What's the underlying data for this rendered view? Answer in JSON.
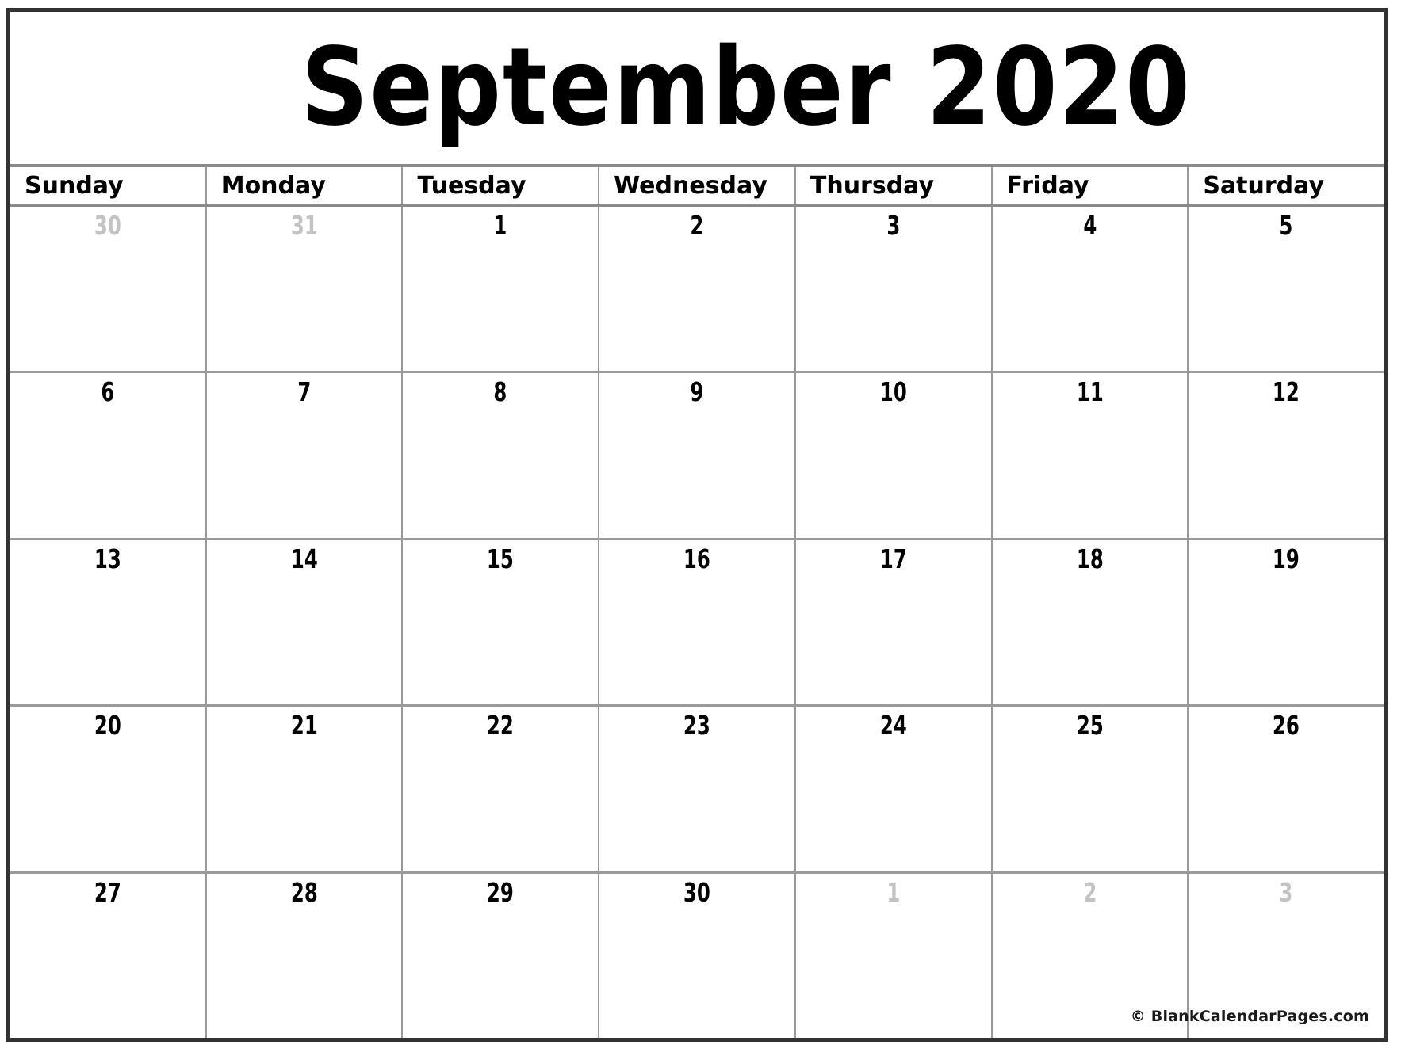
{
  "title": "September 2020",
  "month": "September",
  "year": "2020",
  "weekdays": [
    "Sunday",
    "Monday",
    "Tuesday",
    "Wednesday",
    "Thursday",
    "Friday",
    "Saturday"
  ],
  "weeks": [
    [
      {
        "day": "30",
        "muted": true
      },
      {
        "day": "31",
        "muted": true
      },
      {
        "day": "1",
        "muted": false
      },
      {
        "day": "2",
        "muted": false
      },
      {
        "day": "3",
        "muted": false
      },
      {
        "day": "4",
        "muted": false
      },
      {
        "day": "5",
        "muted": false
      }
    ],
    [
      {
        "day": "6",
        "muted": false
      },
      {
        "day": "7",
        "muted": false
      },
      {
        "day": "8",
        "muted": false
      },
      {
        "day": "9",
        "muted": false
      },
      {
        "day": "10",
        "muted": false
      },
      {
        "day": "11",
        "muted": false
      },
      {
        "day": "12",
        "muted": false
      }
    ],
    [
      {
        "day": "13",
        "muted": false
      },
      {
        "day": "14",
        "muted": false
      },
      {
        "day": "15",
        "muted": false
      },
      {
        "day": "16",
        "muted": false
      },
      {
        "day": "17",
        "muted": false
      },
      {
        "day": "18",
        "muted": false
      },
      {
        "day": "19",
        "muted": false
      }
    ],
    [
      {
        "day": "20",
        "muted": false
      },
      {
        "day": "21",
        "muted": false
      },
      {
        "day": "22",
        "muted": false
      },
      {
        "day": "23",
        "muted": false
      },
      {
        "day": "24",
        "muted": false
      },
      {
        "day": "25",
        "muted": false
      },
      {
        "day": "26",
        "muted": false
      }
    ],
    [
      {
        "day": "27",
        "muted": false
      },
      {
        "day": "28",
        "muted": false
      },
      {
        "day": "29",
        "muted": false
      },
      {
        "day": "30",
        "muted": false
      },
      {
        "day": "1",
        "muted": true
      },
      {
        "day": "2",
        "muted": true
      },
      {
        "day": "3",
        "muted": true
      }
    ]
  ],
  "credit": "© BlankCalendarPages.com",
  "colors": {
    "outer_border": "#333333",
    "grid_line": "#9a9a9a",
    "day_text": "#000000",
    "muted_day_text": "#c3c3c3",
    "background": "#ffffff"
  }
}
